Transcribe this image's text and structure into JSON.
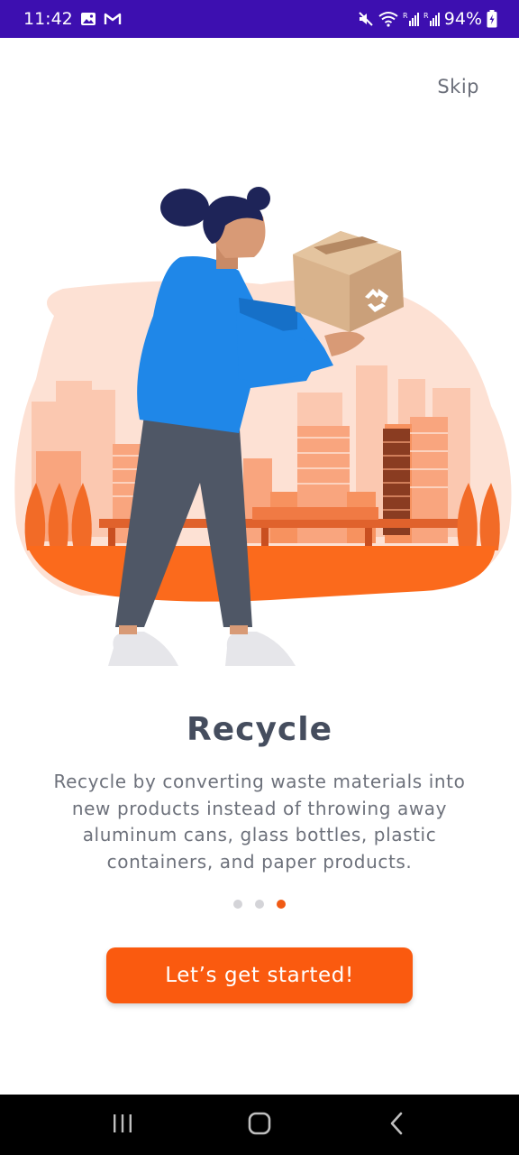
{
  "status_bar": {
    "time": "11:42",
    "left_icons": [
      "image-icon",
      "gmail-icon"
    ],
    "right_icons": [
      "mute-icon",
      "wifi-icon",
      "signal-r-icon",
      "signal-r-icon",
      "battery-charging-icon"
    ],
    "battery": "94%",
    "background": "#3d0fb0"
  },
  "header": {
    "skip_label": "Skip"
  },
  "onboarding": {
    "illustration": "person-carrying-recycle-box-city-illustration",
    "title": "Recycle",
    "description": "Recycle by converting waste materials into new products instead of throwing away aluminum cans, glass bottles, plastic containers, and paper products.",
    "page_count": 3,
    "active_page": 3,
    "accent": "#f05a14"
  },
  "cta": {
    "label": "Let’s get started!",
    "color": "#fa5a0f"
  },
  "nav_bar": {
    "buttons": [
      "recents-icon",
      "home-icon",
      "back-icon"
    ]
  }
}
